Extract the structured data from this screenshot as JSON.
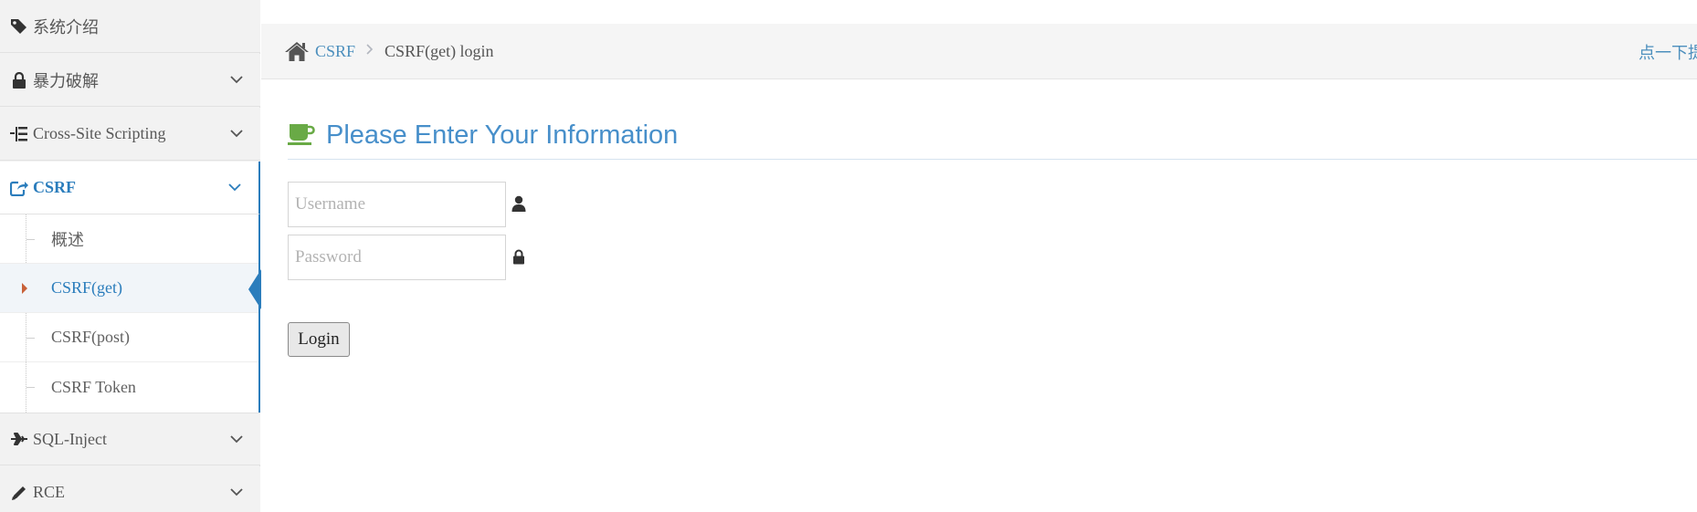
{
  "sidebar": {
    "items": [
      {
        "label": "系统介绍",
        "icon": "tags-icon"
      },
      {
        "label": "暴力破解",
        "icon": "lock-icon"
      },
      {
        "label": "Cross-Site Scripting",
        "icon": "list-tree-icon"
      },
      {
        "label": "CSRF",
        "icon": "share-square-icon"
      },
      {
        "label": "SQL-Inject",
        "icon": "plane-icon"
      },
      {
        "label": "RCE",
        "icon": "pencil-icon"
      }
    ],
    "csrf_submenu": [
      {
        "label": "概述"
      },
      {
        "label": "CSRF(get)"
      },
      {
        "label": "CSRF(post)"
      },
      {
        "label": "CSRF Token"
      }
    ],
    "active_item": "CSRF",
    "active_subitem": "CSRF(get)"
  },
  "breadcrumb": {
    "link": "CSRF",
    "current": "CSRF(get) login",
    "right_link": "点一下提示~"
  },
  "main": {
    "title": "Please Enter Your Information",
    "username_placeholder": "Username",
    "password_placeholder": "Password",
    "login_label": "Login"
  },
  "colors": {
    "accent": "#2b7dbc",
    "title": "#478fca",
    "link": "#4c8fbd",
    "cup": "#69aa46",
    "caret": "#c86139"
  }
}
